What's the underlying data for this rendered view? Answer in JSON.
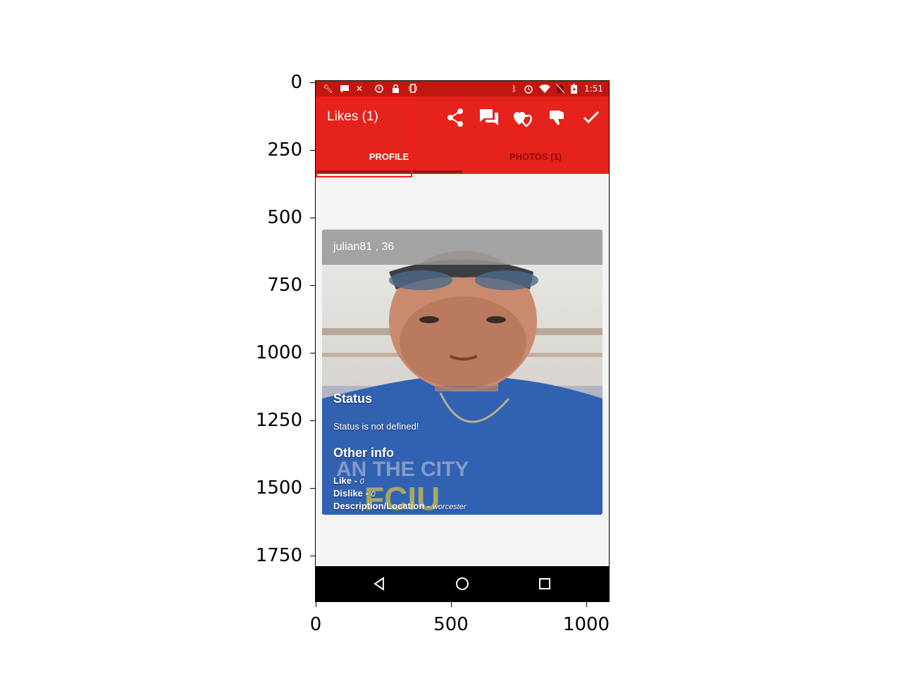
{
  "axes": {
    "y_ticks": [
      "0",
      "250",
      "500",
      "750",
      "1000",
      "1250",
      "1500",
      "1750"
    ],
    "x_ticks": [
      "0",
      "500",
      "1000"
    ]
  },
  "status_bar": {
    "time": "1:51",
    "icons": [
      "wrench-icon",
      "message-icon",
      "satellite-icon",
      "alert-icon",
      "lock-icon",
      "vibrate-icon",
      "bluetooth-icon",
      "alarm-icon",
      "wifi-icon",
      "no-sim-icon",
      "battery-icon"
    ]
  },
  "app_bar": {
    "title": "Likes (1)",
    "actions": [
      "share-icon",
      "chat-icon",
      "hearts-icon",
      "thumbs-down-icon",
      "check-icon"
    ]
  },
  "tabs": [
    {
      "label": "PROFILE",
      "active": true
    },
    {
      "label": "PHOTOS (1)",
      "active": false
    }
  ],
  "profile": {
    "name_age": "julian81 , 36",
    "status_heading": "Status",
    "status_text": "Status is not defined!",
    "other_info_heading": "Other info",
    "info": [
      {
        "label": "Like - ",
        "value": "0"
      },
      {
        "label": "Dislike - ",
        "value": "0"
      },
      {
        "label": "Description/Location - ",
        "value": "worcester"
      }
    ]
  },
  "colors": {
    "status_bar": "#c1170f",
    "app_bar": "#e5221b",
    "tab_indicator": "#a01510",
    "highlight": "#ff1a1a"
  }
}
